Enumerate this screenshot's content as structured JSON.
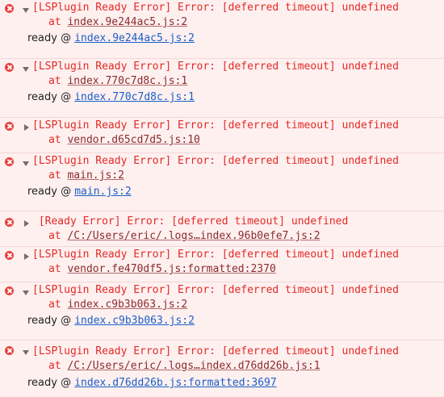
{
  "entries": [
    {
      "message": "[LSPlugin Ready Error] Error: [deferred timeout] undefined",
      "at_prefix": "at ",
      "at_source": "index.9e244ac5.js:2",
      "ready_prefix": "ready @ ",
      "ready_link": "index.9e244ac5.js:2",
      "expanded": true
    },
    {
      "message": "[LSPlugin Ready Error] Error: [deferred timeout] undefined",
      "at_prefix": "at ",
      "at_source": "index.770c7d8c.js:1",
      "ready_prefix": "ready @ ",
      "ready_link": "index.770c7d8c.js:1",
      "expanded": true
    },
    {
      "message": "[LSPlugin Ready Error] Error: [deferred timeout] undefined",
      "at_prefix": "at ",
      "at_source": "vendor.d65cd7d5.js:10",
      "expanded": false
    },
    {
      "message": "[LSPlugin Ready Error] Error: [deferred timeout] undefined",
      "at_prefix": "at ",
      "at_source": "main.js:2",
      "ready_prefix": "ready @ ",
      "ready_link": "main.js:2",
      "expanded": true
    },
    {
      "message": " [Ready Error] Error: [deferred timeout] undefined",
      "at_prefix": "at ",
      "at_source": "/C:/Users/eric/.logs…index.96b0efe7.js:2",
      "expanded": false
    },
    {
      "message": "[LSPlugin Ready Error] Error: [deferred timeout] undefined",
      "at_prefix": "at ",
      "at_source": "vendor.fe470df5.js:formatted:2370",
      "expanded": false
    },
    {
      "message": "[LSPlugin Ready Error] Error: [deferred timeout] undefined",
      "at_prefix": "at ",
      "at_source": "index.c9b3b063.js:2",
      "ready_prefix": "ready @ ",
      "ready_link": "index.c9b3b063.js:2",
      "expanded": true
    },
    {
      "message": "[LSPlugin Ready Error] Error: [deferred timeout] undefined",
      "at_prefix": "at ",
      "at_source": "/C:/Users/eric/.logs…index.d76dd26b.js:1",
      "ready_prefix": "ready @ ",
      "ready_link": "index.d76dd26b.js:formatted:3697",
      "expanded": true
    }
  ]
}
